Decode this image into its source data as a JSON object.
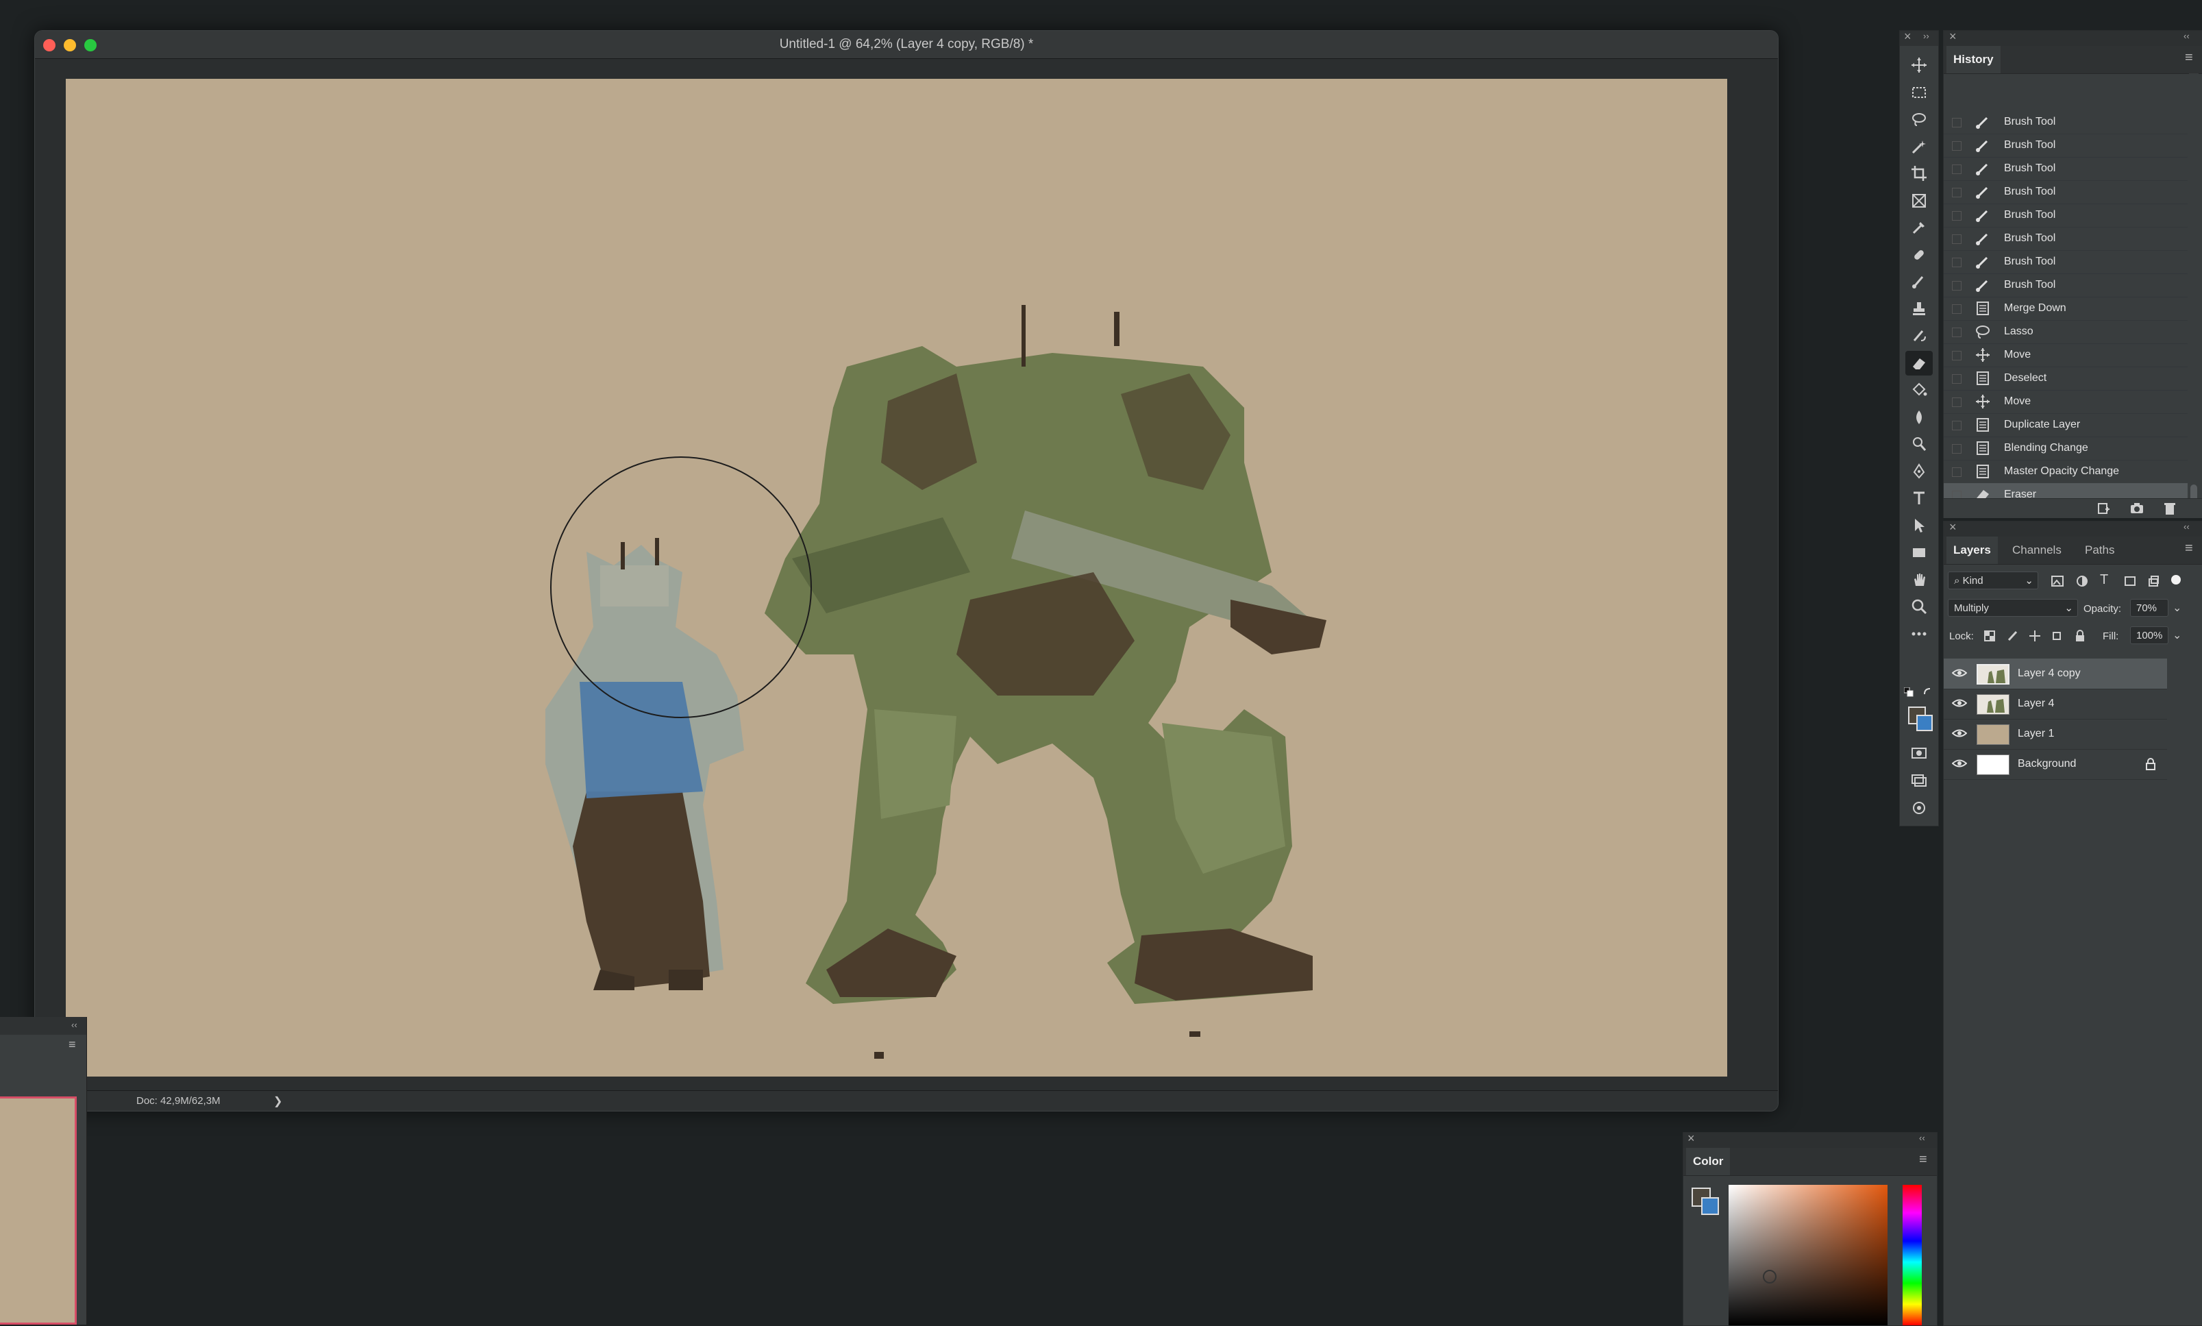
{
  "document": {
    "title": "Untitled-1 @ 64,2% (Layer 4 copy, RGB/8) *",
    "doc_size": "Doc: 42,9M/62,3M",
    "status_arrow": "❯"
  },
  "colors": {
    "canvas": "#bba98e",
    "robot": "#6e7a4e",
    "figure_jacket": "#9da59a",
    "figure_overlay": "#4f7aa6",
    "dark_brown": "#4b3c2c",
    "traffic_close": "#ff5f57",
    "traffic_min": "#febc2e",
    "traffic_max": "#28c840"
  },
  "toolbar": {
    "tools": [
      "move-tool-icon",
      "marquee-tool-icon",
      "lasso-tool-icon",
      "magic-wand-icon",
      "crop-tool-icon",
      "frame-tool-icon",
      "eyedropper-icon",
      "healing-brush-icon",
      "brush-tool-icon",
      "clone-stamp-icon",
      "history-brush-icon",
      "eraser-tool-icon",
      "paint-bucket-icon",
      "blur-tool-icon",
      "dodge-tool-icon",
      "pen-tool-icon",
      "type-tool-icon",
      "path-selection-icon",
      "rectangle-tool-icon",
      "hand-tool-icon",
      "zoom-tool-icon",
      "more-tools-icon"
    ]
  },
  "history": {
    "title": "History",
    "items": [
      {
        "label": "Brush Tool",
        "icon": "brush"
      },
      {
        "label": "Brush Tool",
        "icon": "brush"
      },
      {
        "label": "Brush Tool",
        "icon": "brush"
      },
      {
        "label": "Brush Tool",
        "icon": "brush"
      },
      {
        "label": "Brush Tool",
        "icon": "brush"
      },
      {
        "label": "Brush Tool",
        "icon": "brush"
      },
      {
        "label": "Brush Tool",
        "icon": "brush"
      },
      {
        "label": "Brush Tool",
        "icon": "brush"
      },
      {
        "label": "Merge Down",
        "icon": "doc"
      },
      {
        "label": "Lasso",
        "icon": "lasso"
      },
      {
        "label": "Move",
        "icon": "move"
      },
      {
        "label": "Deselect",
        "icon": "doc"
      },
      {
        "label": "Move",
        "icon": "move"
      },
      {
        "label": "Duplicate Layer",
        "icon": "doc"
      },
      {
        "label": "Blending Change",
        "icon": "doc"
      },
      {
        "label": "Master Opacity Change",
        "icon": "doc"
      },
      {
        "label": "Eraser",
        "icon": "eraser"
      }
    ]
  },
  "layers_panel": {
    "tabs": [
      "Layers",
      "Channels",
      "Paths"
    ],
    "filter_kind": "Kind",
    "blend_mode": "Multiply",
    "opacity_label": "Opacity:",
    "opacity_value": "70%",
    "lock_label": "Lock:",
    "fill_label": "Fill:",
    "fill_value": "100%",
    "layers": [
      {
        "name": "Layer 4 copy",
        "selected": true
      },
      {
        "name": "Layer 4",
        "selected": false
      },
      {
        "name": "Layer 1",
        "selected": false
      },
      {
        "name": "Background",
        "selected": false
      }
    ]
  },
  "color_panel": {
    "title": "Color"
  }
}
